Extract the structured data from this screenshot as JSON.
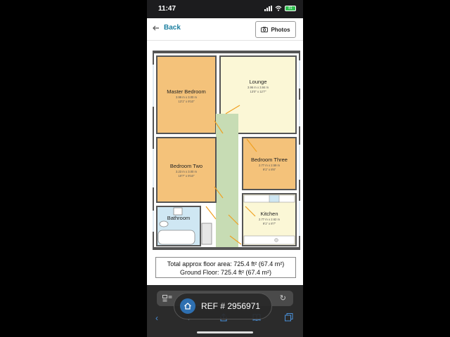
{
  "status": {
    "time": "11:47",
    "battery": "81"
  },
  "nav": {
    "back_label": "Back",
    "photos_label": "Photos"
  },
  "rooms": {
    "master": {
      "name": "Master Bedroom",
      "dim_m": "3.99 m x 3.00 m",
      "dim_ft": "13'1\" x 9'10\""
    },
    "lounge": {
      "name": "Lounge",
      "dim_m": "3.96 m x 3.84 m",
      "dim_ft": "13'0\" x 12'7\""
    },
    "bedroom2": {
      "name": "Bedroom Two",
      "dim_m": "3.23 m x 3.00 m",
      "dim_ft": "10'7\" x 9'10\""
    },
    "bedroom3": {
      "name": "Bedroom Three",
      "dim_m": "2.77 m x 2.59 m",
      "dim_ft": "9'1\" x 8'6\""
    },
    "bathroom": {
      "name": "Bathroom"
    },
    "kitchen": {
      "name": "Kitchen",
      "dim_m": "2.77 m x 2.62 m",
      "dim_ft": "9'1\" x 8'7\""
    }
  },
  "area": {
    "line1": "Total approx floor area: 725.4 ft² (67.4 m²)",
    "line2": "Ground Floor: 725.4 ft² (67.4 m²)"
  },
  "ref": {
    "label": "REF # 2956971"
  },
  "colors": {
    "bedroom": "#f4c27a",
    "lounge": "#fbf7d6",
    "hall": "#c7dcb4",
    "bath": "#cfe7f3",
    "wall": "#555555"
  }
}
